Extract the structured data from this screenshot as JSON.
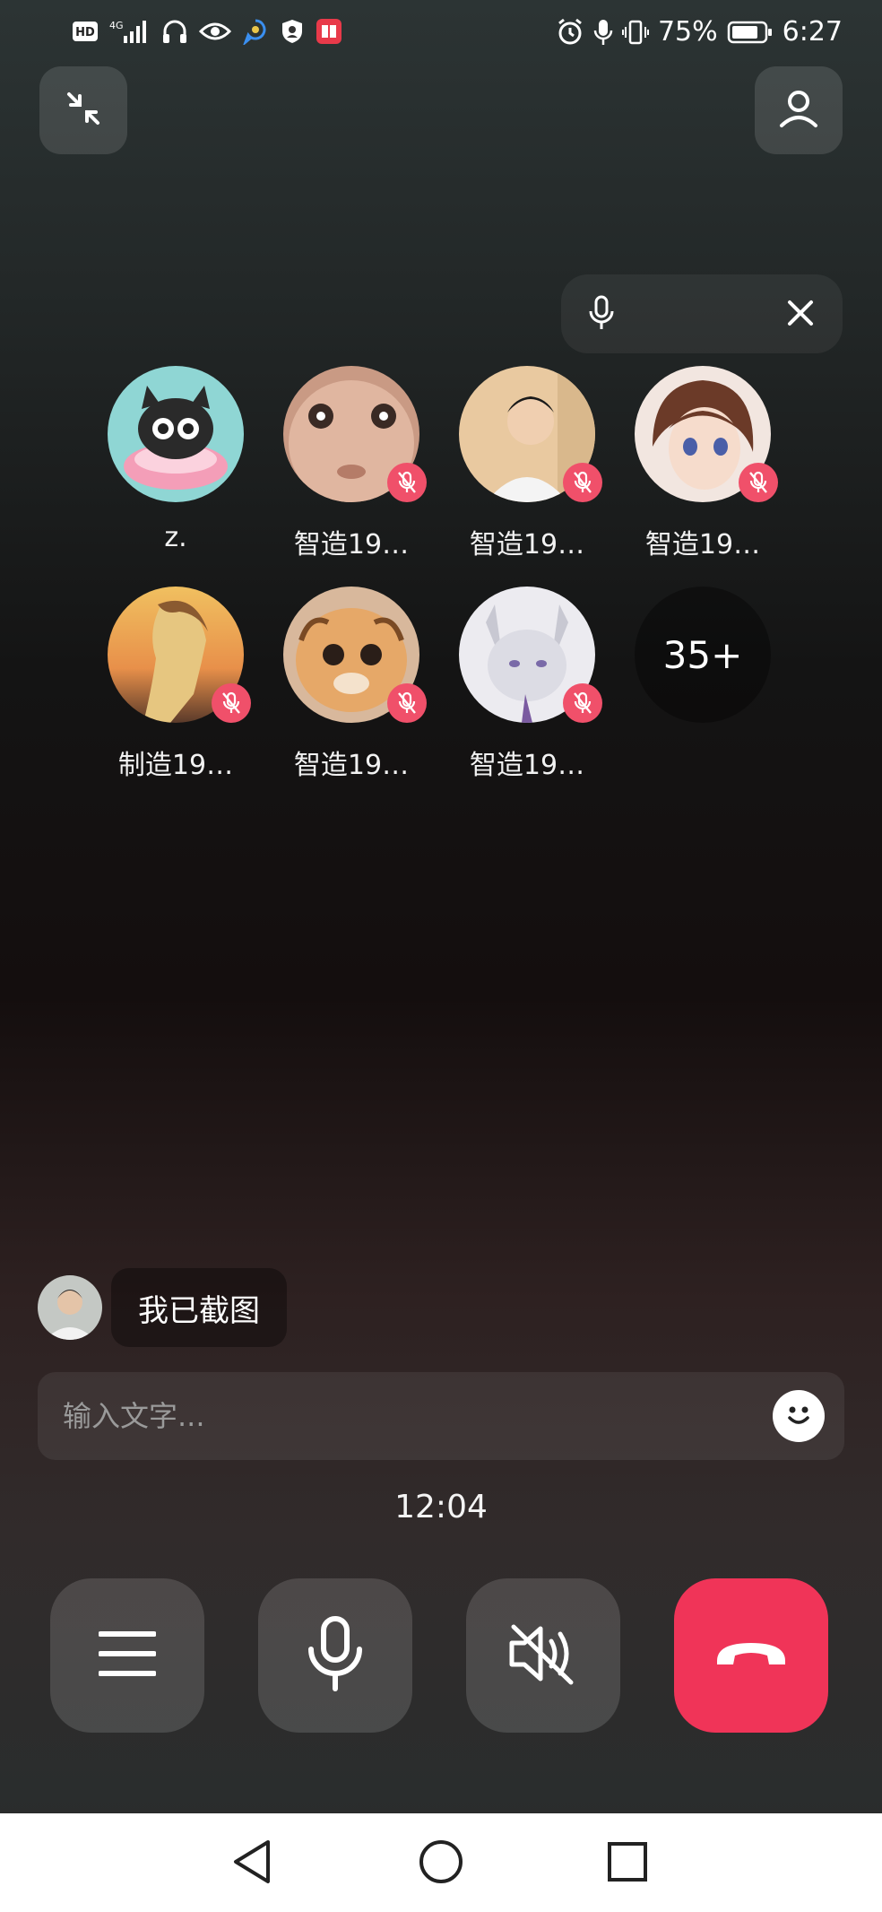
{
  "status_bar": {
    "hd": "HD",
    "network": "4G",
    "battery": "75%",
    "time": "6:27"
  },
  "participants_row1": [
    {
      "name": "z.",
      "muted": false
    },
    {
      "name": "智造19…",
      "muted": true
    },
    {
      "name": "智造19…",
      "muted": true
    },
    {
      "name": "智造19…",
      "muted": true
    }
  ],
  "participants_row2": [
    {
      "name": "制造19…",
      "muted": true
    },
    {
      "name": "智造19…",
      "muted": true
    },
    {
      "name": "智造19…",
      "muted": true
    }
  ],
  "more_count": "35+",
  "chat": {
    "message": "我已截图"
  },
  "input": {
    "placeholder": "输入文字..."
  },
  "call_timer": "12:04",
  "colors": {
    "hangup": "#f03458",
    "mute_badge": "#f0506a"
  }
}
